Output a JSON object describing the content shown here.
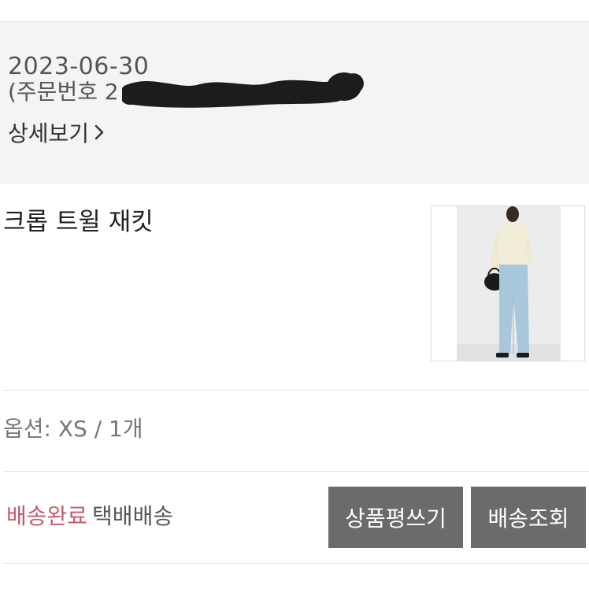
{
  "order": {
    "date": "2023-06-30",
    "order_number_label": "(주문번호 2",
    "detail_link": "상세보기"
  },
  "product": {
    "name": "크롭 트윌 재킷",
    "option": "옵션: XS /  1개"
  },
  "delivery": {
    "status": "배송완료",
    "method": "택배배송"
  },
  "actions": {
    "review_button": "상품평쓰기",
    "track_button": "배송조회"
  },
  "colors": {
    "status_accent": "#c25a6a",
    "button_bg": "#6b6b6b",
    "header_bg": "#f4f4f4"
  },
  "icons": {
    "detail_chevron": "chevron-right-icon"
  }
}
